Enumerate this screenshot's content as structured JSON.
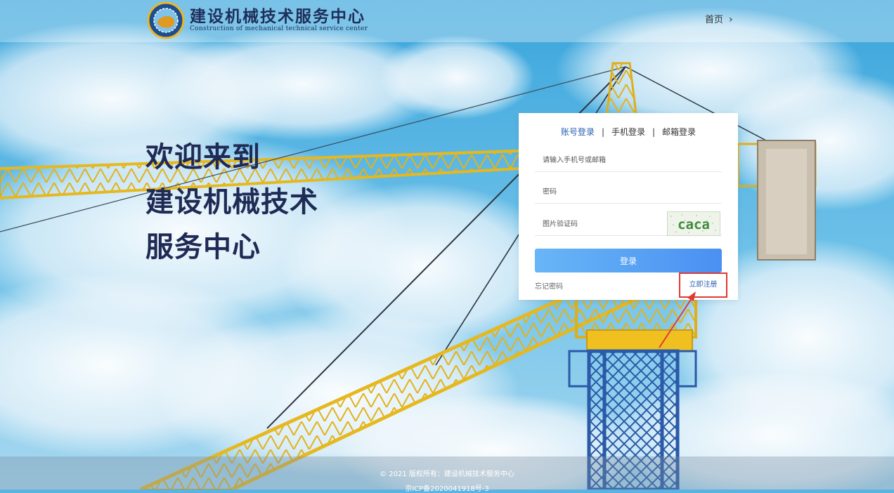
{
  "header": {
    "brand_cn": "建设机械技术服务中心",
    "brand_en": "Construction of mechanical technical service center",
    "nav_home": "首页",
    "nav_chevron": "›"
  },
  "welcome": {
    "lines": [
      "欢迎来到",
      "建设机械技术",
      "服务中心"
    ]
  },
  "login": {
    "tabs": [
      "账号登录",
      "手机登录",
      "邮箱登录"
    ],
    "tab_separator": "|",
    "active_tab": 0,
    "username_placeholder": "请输入手机号或邮箱",
    "password_placeholder": "密码",
    "captcha_placeholder": "图片验证码",
    "captcha_text": "caca",
    "submit_label": "登录",
    "forgot_label": "忘记密码",
    "register_label": "立即注册"
  },
  "footer": {
    "copyright": "© 2021 版权所有：建设机械技术服务中心",
    "icp": "京ICP备2020041918号-3"
  },
  "colors": {
    "brand_dark": "#1e2f5a",
    "accent_blue": "#2b5fb3",
    "button_blue": "#4a90f2",
    "highlight_red": "#e03a32"
  },
  "icons": {
    "logo": "gear-globe-logo",
    "nav": "chevron-right-icon",
    "annotation": "red-arrow-annotation"
  }
}
